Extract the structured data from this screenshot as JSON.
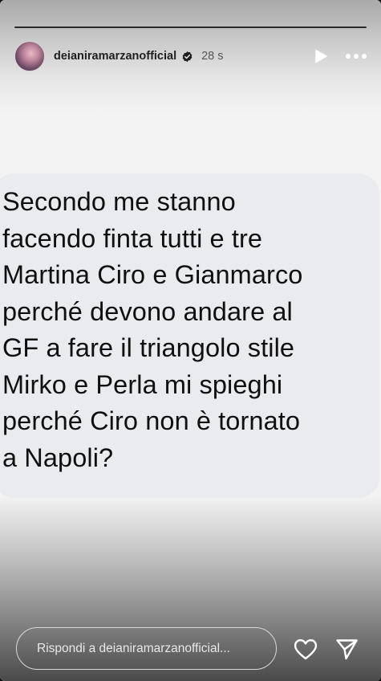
{
  "header": {
    "username": "deianiramarzanofficial",
    "time": "28 s",
    "avatar_icon": "profile-avatar",
    "verified_icon": "verified-badge-icon"
  },
  "progress": {
    "segments": 1,
    "active_segment": 1
  },
  "message": {
    "text": "Secondo me stanno\nfacendo finta tutti e tre\nMartina Ciro e Gianmarco\nperché devono andare al\nGF  a fare il triangolo stile\nMirko e Perla mi spieghi\nperché Ciro non è tornato\na Napoli?"
  },
  "reply": {
    "placeholder": "Rispondi a deianiramarzanofficial..."
  },
  "icons": {
    "play": "play-icon",
    "more": "more-options-icon",
    "heart": "heart-icon",
    "send": "send-icon"
  },
  "colors": {
    "bubble": "#e9ebef",
    "text": "#101010",
    "background": "#f3f3f3"
  }
}
